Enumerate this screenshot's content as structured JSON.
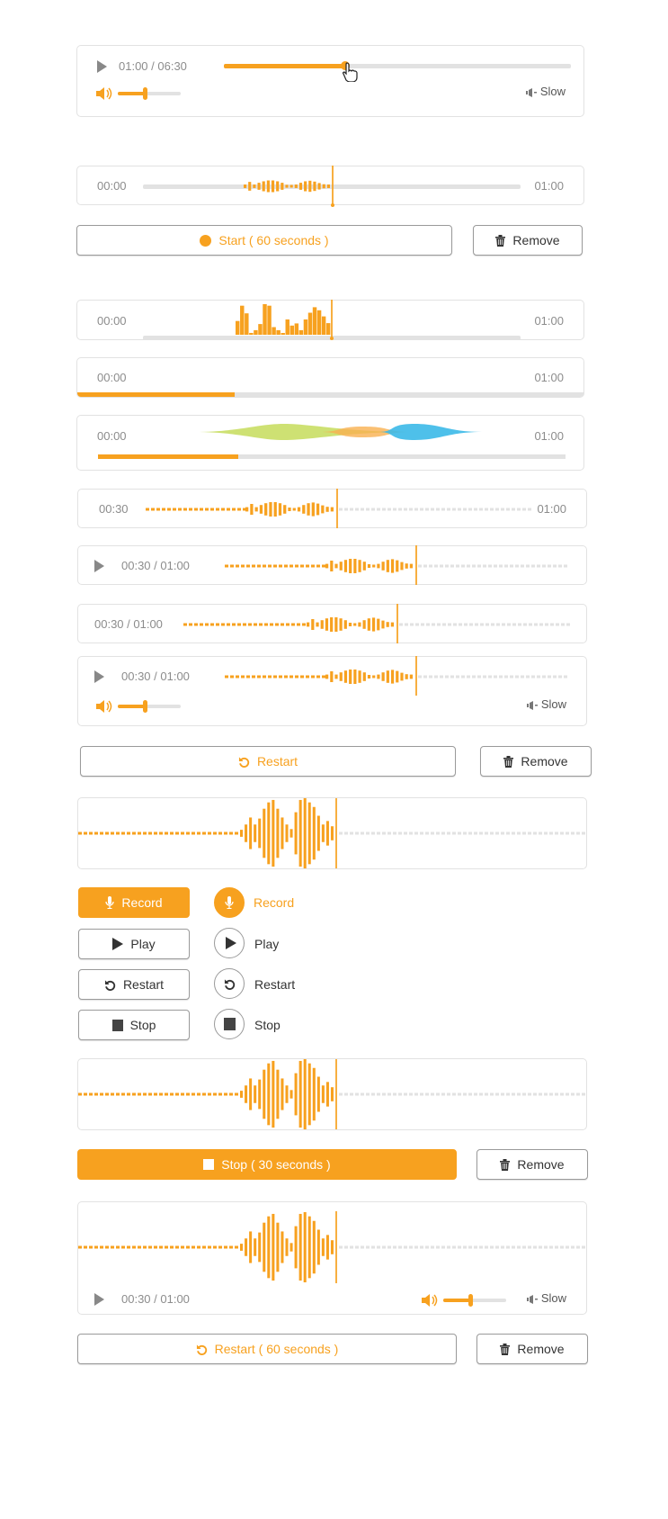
{
  "colors": {
    "accent": "#F7A11F",
    "track": "#e2e2e2",
    "text_muted": "#8c8c8c",
    "green": "#c6dc5a",
    "orange_soft": "#f9b050",
    "blue": "#3bb9e8"
  },
  "player_full": {
    "time": "01:00 / 06:30",
    "progress": 0.35,
    "volume": 0.43,
    "speed_label": "Slow"
  },
  "record_timeline": {
    "start": "00:00",
    "end": "01:00",
    "playhead": 0.5
  },
  "record_buttons": {
    "start_label": "Start ( 60 seconds )",
    "remove_label": "Remove"
  },
  "histogram_timeline": {
    "start": "00:00",
    "end": "01:00",
    "bars": [
      0.45,
      0.95,
      0.7,
      0.06,
      0.15,
      0.35,
      1.0,
      0.95,
      0.25,
      0.15,
      0.05,
      0.5,
      0.3,
      0.37,
      0.15,
      0.5,
      0.72,
      0.9,
      0.8,
      0.6,
      0.38
    ]
  },
  "progress_timeline": {
    "start": "00:00",
    "end": "01:00",
    "progress": 0.31
  },
  "blob_timeline": {
    "start": "00:00",
    "end": "01:00",
    "progress": 0.3
  },
  "wave_a": {
    "start": "00:30",
    "end": "01:00"
  },
  "wave_b": {
    "time": "00:30 / 01:00"
  },
  "wave_c": {
    "time": "00:30 / 01:00"
  },
  "wave_d": {
    "time": "00:30 / 01:00",
    "volume": 0.43,
    "speed_label": "Slow"
  },
  "restart_row": {
    "restart_label": "Restart",
    "remove_label": "Remove"
  },
  "control_buttons": {
    "record": "Record",
    "play": "Play",
    "restart": "Restart",
    "stop": "Stop"
  },
  "stop_row": {
    "stop_label": "Stop ( 30 seconds )",
    "remove_label": "Remove"
  },
  "wave_e": {
    "time": "00:30 / 01:00",
    "volume": 0.43,
    "speed_label": "Slow"
  },
  "restart60_row": {
    "restart_label": "Restart ( 60 seconds )",
    "remove_label": "Remove"
  },
  "waveform_small": [
    0.3,
    0.75,
    0.3,
    0.6,
    0.85,
    1.0,
    1.0,
    0.85,
    0.6,
    0.25,
    0.15,
    0.3,
    0.6,
    0.85,
    0.95,
    0.8,
    0.55,
    0.35,
    0.3
  ],
  "waveform_big": [
    0.1,
    0.25,
    0.45,
    0.25,
    0.42,
    0.7,
    0.88,
    0.95,
    0.7,
    0.45,
    0.25,
    0.12,
    0.6,
    0.95,
    1.0,
    0.88,
    0.75,
    0.5,
    0.25,
    0.35,
    0.2
  ]
}
